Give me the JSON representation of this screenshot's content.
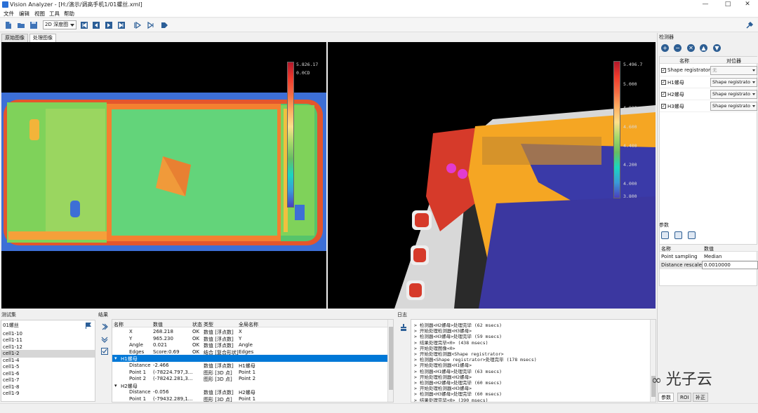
{
  "window": {
    "title": "Vision Analyzer - [H:/演示/调高手机1/01螺丝.xml]",
    "buttons": {
      "minimize": "—",
      "maximize": "□",
      "close": "✕"
    }
  },
  "menu": [
    "文件",
    "编辑",
    "视图",
    "工具",
    "帮助"
  ],
  "toolbar": {
    "select_value": "2D 深度图",
    "icons": [
      "new-file-icon",
      "open-folder-icon",
      "save-icon",
      "first-icon",
      "prev-icon",
      "next-icon",
      "last-icon",
      "step-icon",
      "run-icon",
      "play-icon",
      "settings-icon"
    ]
  },
  "view_tabs": [
    "原始图像",
    "处理图像"
  ],
  "left_view": {
    "colorbar_top": "5.826.17",
    "colorbar_mid": "0.0CD"
  },
  "right_view": {
    "colorbar_labels": [
      "5.496.7",
      "5.000",
      "4.800",
      "4.600",
      "4.400",
      "4.200",
      "4.000",
      "3.800"
    ]
  },
  "detector_panel": {
    "title": "检测器",
    "buttons": [
      "+",
      "−",
      "✕",
      "▲",
      "▼"
    ],
    "columns": [
      "名称",
      "对位器"
    ],
    "rows": [
      {
        "checked": true,
        "name": "Shape registrator",
        "aligner": "无"
      },
      {
        "checked": true,
        "name": "H1螺母",
        "aligner": "Shape registrato"
      },
      {
        "checked": true,
        "name": "H2螺母",
        "aligner": "Shape registrato"
      },
      {
        "checked": true,
        "name": "H3螺母",
        "aligner": "Shape registrato"
      }
    ]
  },
  "params_panel": {
    "title": "参数",
    "columns": [
      "名称",
      "数值"
    ],
    "rows": [
      {
        "name": "Point sampling",
        "value": "Median"
      },
      {
        "name": "Distance rescale",
        "value": "0.0010000"
      }
    ]
  },
  "bottom_tabs": [
    "参数",
    "ROI",
    "补正"
  ],
  "test_set": {
    "title": "测试集",
    "header": "01螺丝",
    "items": [
      "cell1-10",
      "cell1-11",
      "cell1-12",
      "cell1-2",
      "cell1-4",
      "cell1-5",
      "cell1-6",
      "cell1-7",
      "cell1-8",
      "cell1-9"
    ],
    "selected_index": 3
  },
  "results": {
    "title": "结果",
    "columns": [
      "名称",
      "数值",
      "状态",
      "类型",
      "全局名称"
    ],
    "rows": [
      {
        "indent": 2,
        "name": "X",
        "value": "268.218",
        "status": "OK",
        "type": "数值 [浮点数]",
        "global": "X"
      },
      {
        "indent": 2,
        "name": "Y",
        "value": "965.230",
        "status": "OK",
        "type": "数值 [浮点数]",
        "global": "Y"
      },
      {
        "indent": 2,
        "name": "Angle",
        "value": "0.021",
        "status": "OK",
        "type": "数值 [浮点数]",
        "global": "Angle"
      },
      {
        "indent": 2,
        "name": "Edges",
        "value": "Score:0.69",
        "status": "OK",
        "type": "结合 [复合形状]",
        "global": "Edges"
      },
      {
        "indent": 0,
        "name": "H1螺母",
        "value": "",
        "status": "",
        "type": "",
        "global": "",
        "group": true,
        "selected": true
      },
      {
        "indent": 2,
        "name": "Distance",
        "value": "-2.466",
        "status": "",
        "type": "数值 [浮点数]",
        "global": "H1螺母"
      },
      {
        "indent": 2,
        "name": "Point 1",
        "value": "(-78224.797,3...",
        "status": "",
        "type": "图形 [3D 点]",
        "global": "Point 1"
      },
      {
        "indent": 2,
        "name": "Point 2",
        "value": "(-78242.281,3...",
        "status": "",
        "type": "图形 [3D 点]",
        "global": "Point 2"
      },
      {
        "indent": 0,
        "name": "H2螺母",
        "value": "",
        "status": "",
        "type": "",
        "global": "",
        "group": true
      },
      {
        "indent": 2,
        "name": "Distance",
        "value": "-0.056",
        "status": "",
        "type": "数值 [浮点数]",
        "global": "H2螺母"
      },
      {
        "indent": 2,
        "name": "Point 1",
        "value": "(-79432.289,1...",
        "status": "",
        "type": "图形 [3D 点]",
        "global": "Point 1"
      }
    ]
  },
  "log": {
    "title": "日志",
    "lines": [
      "> 检测器<H2螺母>处理完毕 (62 msecs)",
      "> 开始处理检测器<H3螺母>",
      "> 检测器<H3螺母>处理完毕 (59 msecs)",
      "> 结果处理完毕<0> (438 msecs)",
      "> 开始处理图像<0>",
      "> 开始处理检测器<Shape registrator>",
      "> 检测器<Shape registrator>处理完毕 (178 msecs)",
      "> 开始处理检测器<H1螺母>",
      "> 检测器<H1螺母>处理完毕 (63 msecs)",
      "> 开始处理检测器<H2螺母>",
      "> 检测器<H2螺母>处理完毕 (60 msecs)",
      "> 开始处理检测器<H3螺母>",
      "> 检测器<H3螺母>处理完毕 (60 msecs)",
      "> 结果处理完毕<0> (390 msecs)"
    ]
  },
  "watermark": "光子云"
}
